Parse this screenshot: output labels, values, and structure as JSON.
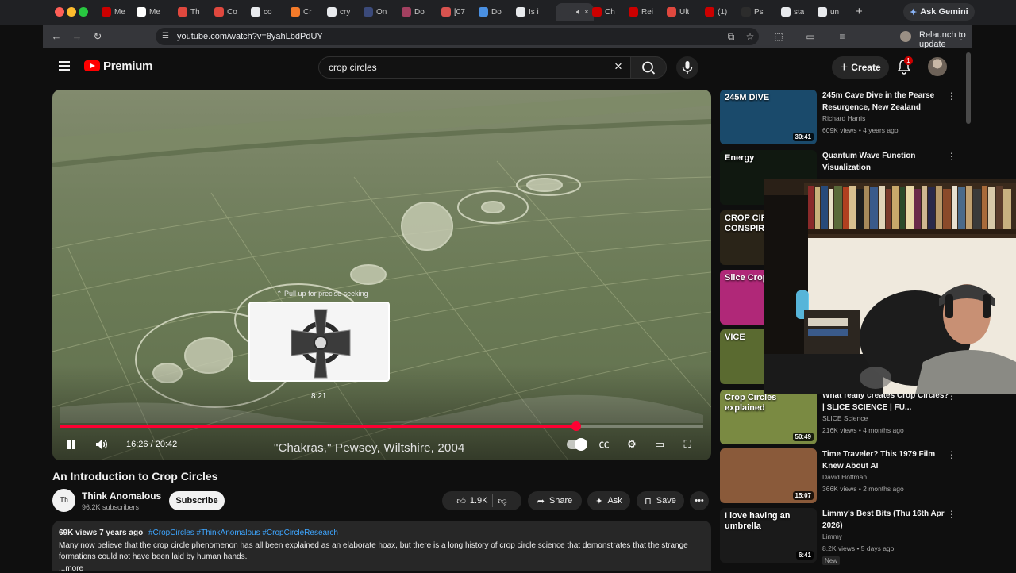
{
  "browser": {
    "tabs": [
      {
        "label": "Me",
        "color": "#cc0000"
      },
      {
        "label": "Me",
        "color": "#ffffff"
      },
      {
        "label": "Th",
        "color": "#e0483e"
      },
      {
        "label": "Co",
        "color": "#e0483e"
      },
      {
        "label": "co",
        "color": "#e8eaed"
      },
      {
        "label": "Cr",
        "color": "#f47b2a"
      },
      {
        "label": "cry",
        "color": "#e8eaed"
      },
      {
        "label": "On",
        "color": "#3b4a7a"
      },
      {
        "label": "Do",
        "color": "#a34060"
      },
      {
        "label": "[07",
        "color": "#d9534f"
      },
      {
        "label": "Do",
        "color": "#4a90e2"
      },
      {
        "label": "Is i",
        "color": "#e8eaed"
      },
      {
        "label": "",
        "color": "#35363a",
        "active": true
      },
      {
        "label": "Ch",
        "color": "#cc0000"
      },
      {
        "label": "Rei",
        "color": "#cc0000"
      },
      {
        "label": "Ult",
        "color": "#e0483e"
      },
      {
        "label": "(1)",
        "color": "#cc0000"
      },
      {
        "label": "Ps",
        "color": "#2c2c2c"
      },
      {
        "label": "sta",
        "color": "#e8eaed"
      },
      {
        "label": "un",
        "color": "#e8eaed"
      }
    ],
    "new_tab": "+",
    "ask_gemini": "Ask Gemini",
    "url": "youtube.com/watch?v=8yahLbdPdUY",
    "relaunch": "Relaunch to update"
  },
  "masthead": {
    "brand": "Premium",
    "search_value": "crop circles",
    "create_label": "Create",
    "notification_count": "1"
  },
  "player": {
    "seek_hint": "Pull up for precise seeking",
    "preview_time": "8:21",
    "current_time": "16:26",
    "duration": "20:42",
    "time_display": "16:26 / 20:42",
    "progress_fraction": 0.803,
    "caption": "\"Chakras,\" Pewsey, Wiltshire, 2004"
  },
  "video": {
    "title": "An Introduction to Crop Circles",
    "channel_initials": "Th",
    "channel_name": "Think Anomalous",
    "subscribers": "96.2K subscribers",
    "subscribe_label": "Subscribe",
    "likes": "1.9K",
    "share_label": "Share",
    "ask_label": "Ask",
    "save_label": "Save",
    "views_date": "69K views  7 years ago",
    "hashtags": "#CropCircles #ThinkAnomalous #CropCircleResearch",
    "description": "Many now believe that the crop circle phenomenon has all been explained as an elaborate hoax, but there is a long history of crop circle science that demonstrates that the strange formations could not have been laid by human hands.",
    "more_label": "...more"
  },
  "recommendations": [
    {
      "title": "245m Cave Dive in the Pearse Resurgence, New Zealand",
      "channel": "Richard Harris",
      "stats": "609K views • 4 years ago",
      "duration": "30:41",
      "thumb_text": "245M DIVE",
      "thumb_color": "#1a4a6b"
    },
    {
      "title": "Quantum Wave Function Visualization",
      "channel": "",
      "stats": "",
      "duration": "",
      "thumb_text": "Energy",
      "thumb_color": "#101810"
    },
    {
      "title": "",
      "channel": "",
      "stats": "",
      "duration": "",
      "thumb_text": "CROP CIR CONSPIRA",
      "thumb_color": "#2a2418"
    },
    {
      "title": "",
      "channel": "",
      "stats": "",
      "duration": "",
      "thumb_text": "Slice Crop",
      "thumb_color": "#b02878"
    },
    {
      "title": "",
      "channel": "",
      "stats": "",
      "duration": "",
      "thumb_text": "VICE",
      "thumb_color": "#5a6a30"
    },
    {
      "title": "What really creates Crop Circles? | SLICE SCIENCE | FU...",
      "channel": "SLICE Science",
      "stats": "216K views • 4 months ago",
      "duration": "50:49",
      "thumb_text": "Crop Circles explained",
      "thumb_color": "#7a8a42"
    },
    {
      "title": "Time Traveler? This 1979 Film Knew About AI",
      "channel": "David Hoffman",
      "stats": "366K views • 2 months ago",
      "duration": "15:07",
      "thumb_text": "",
      "thumb_color": "#8a5a3a"
    },
    {
      "title": "Limmy's Best Bits (Thu 16th Apr 2026)",
      "channel": "Limmy",
      "stats": "8.2K views • 5 days ago",
      "duration": "6:41",
      "badge": "New",
      "thumb_text": "I love having an umbrella",
      "thumb_color": "#1a1a1a"
    }
  ],
  "colors": {
    "youtube_red": "#ff0000",
    "progress_red": "#ff0033",
    "link_blue": "#3ea6ff",
    "background": "#0f0f0f"
  }
}
